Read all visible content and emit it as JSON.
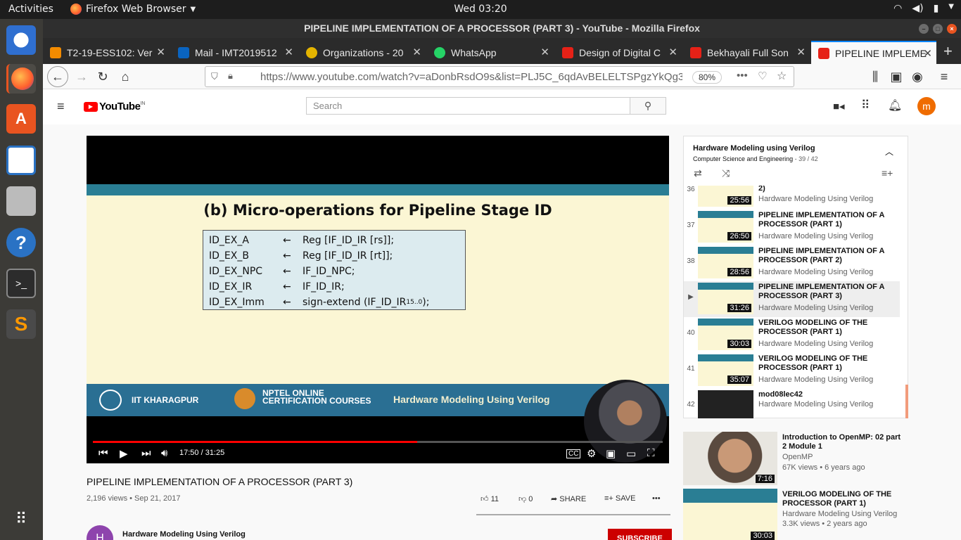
{
  "system": {
    "activities": "Activities",
    "app_name": "Firefox Web Browser",
    "clock": "Wed 03:20"
  },
  "window": {
    "title": "PIPELINE IMPLEMENTATION OF A PROCESSOR (PART 3) - YouTube - Mozilla Firefox"
  },
  "tabs": [
    {
      "label": "T2-19-ESS102: Ver",
      "color": "#f38b00"
    },
    {
      "label": "Mail - IMT2019512",
      "color": "#0a64c0"
    },
    {
      "label": "Organizations - 20",
      "color": "#e4b400"
    },
    {
      "label": "WhatsApp",
      "color": "#25d366"
    },
    {
      "label": "Design of Digital C",
      "color": "#e62117"
    },
    {
      "label": "Bekhayali Full Son",
      "color": "#e62117"
    },
    {
      "label": "PIPELINE IMPLEME",
      "color": "#e62117"
    }
  ],
  "address": {
    "url": "https://www.youtube.com/watch?v=aDonbRsdO9s&list=PLJ5C_6qdAvBELELTSPgzYkQg3H",
    "zoom": "80%"
  },
  "youtube": {
    "logo": "YouTube",
    "region": "IN",
    "search_placeholder": "Search",
    "avatar_letter": "m"
  },
  "video": {
    "slide_title": "(b) Micro-operations for Pipeline Stage ID",
    "code_lines": [
      {
        "lhs": "ID_EX_A",
        "rhs": "Reg [IF_ID_IR [rs]];"
      },
      {
        "lhs": "ID_EX_B",
        "rhs": "Reg [IF_ID_IR [rt]];"
      },
      {
        "lhs": "ID_EX_NPC",
        "rhs": "IF_ID_NPC;"
      },
      {
        "lhs": "ID_EX_IR",
        "rhs": "IF_ID_IR;"
      },
      {
        "lhs": "ID_EX_Imm",
        "rhs": "sign-extend (IF_ID_IR"
      }
    ],
    "sub": "15..0",
    "tail": ");",
    "arrow": "←",
    "strip_left": "IIT KHARAGPUR",
    "strip_mid": "NPTEL ONLINE\nCERTIFICATION COURSES",
    "strip_right": "Hardware Modeling Using Verilog",
    "time": "17:50 / 31:25",
    "progress": 0.569
  },
  "info": {
    "title": "PIPELINE IMPLEMENTATION OF A PROCESSOR (PART 3)",
    "views": "2,196 views • Sep 21, 2017",
    "likes": "11",
    "dislikes": "0",
    "share": "SHARE",
    "save": "SAVE",
    "channel": "Hardware Modeling Using Verilog",
    "subscribe": "SUBSCRIBE"
  },
  "playlist": {
    "title": "Hardware Modeling using Verilog",
    "subtitle": "Computer Science and Engineering",
    "position": " - 39 / 42",
    "items": [
      {
        "idx": "36",
        "title": "2)",
        "channel": "Hardware Modeling Using Verilog",
        "dur": "25:56"
      },
      {
        "idx": "37",
        "title": "PIPELINE IMPLEMENTATION OF A PROCESSOR (PART 1)",
        "channel": "Hardware Modeling Using Verilog",
        "dur": "26:50"
      },
      {
        "idx": "38",
        "title": "PIPELINE IMPLEMENTATION OF A PROCESSOR (PART 2)",
        "channel": "Hardware Modeling Using Verilog",
        "dur": "28:56"
      },
      {
        "idx": "▶",
        "title": "PIPELINE IMPLEMENTATION OF A PROCESSOR (PART 3)",
        "channel": "Hardware Modeling Using Verilog",
        "dur": "31:26"
      },
      {
        "idx": "40",
        "title": "VERILOG MODELING OF THE PROCESSOR (PART 1)",
        "channel": "Hardware Modeling Using Verilog",
        "dur": "30:03"
      },
      {
        "idx": "41",
        "title": "VERILOG MODELING OF THE PROCESSOR (PART 1)",
        "channel": "Hardware Modeling Using Verilog",
        "dur": "35:07"
      },
      {
        "idx": "42",
        "title": "mod08lec42",
        "channel": "Hardware Modeling Using Verilog",
        "dur": ""
      }
    ]
  },
  "recommended": [
    {
      "title": "Introduction to OpenMP: 02 part 2 Module 1",
      "channel": "OpenMP",
      "meta": "67K views • 6 years ago",
      "dur": "7:16"
    },
    {
      "title": "VERILOG MODELING OF THE PROCESSOR (PART 1)",
      "channel": "Hardware Modeling Using Verilog",
      "meta": "3.3K views • 2 years ago",
      "dur": "30:03"
    }
  ]
}
